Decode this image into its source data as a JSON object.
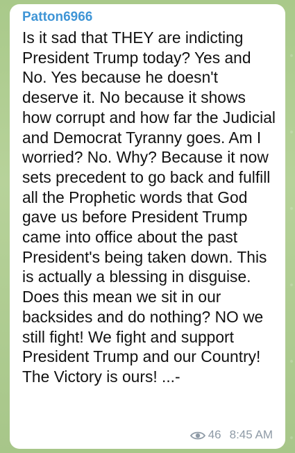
{
  "message": {
    "sender": "Patton6966",
    "text": "Is it sad that THEY are indicting President Trump today? Yes and No. Yes because he doesn't deserve it. No because it shows how corrupt and how far the Judicial and Democrat Tyranny goes. Am I worried? No. Why? Because it now sets precedent to go back and fulfill all the Prophetic words that God gave us before President Trump came into office about the past President's being taken down. This is actually a blessing in disguise. Does this mean we sit in our backsides and do nothing? NO we still fight! We fight and support President Trump and our Country! The Victory is ours! ...-",
    "views": "46",
    "time": "8:45 AM",
    "views_icon": "eye-icon"
  },
  "colors": {
    "sender": "#3f95d6",
    "bubble": "#ffffff",
    "meta": "#8e9aa6",
    "wallpaper": "#b0cd93"
  }
}
